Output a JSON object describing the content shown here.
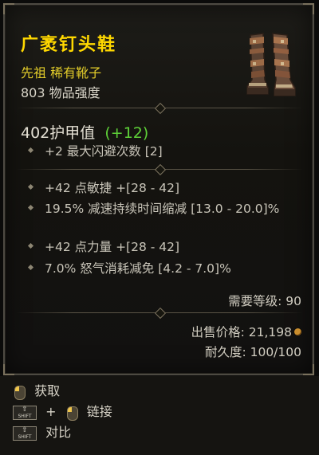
{
  "item": {
    "name": "广袤钉头鞋",
    "type": "先祖 稀有靴子",
    "power": "803 物品强度",
    "icon": "boots-icon"
  },
  "armor": {
    "value": "402护甲值",
    "bonus": "(+12)"
  },
  "implicit": [
    {
      "text": "+2 最大闪避次数 [2]"
    }
  ],
  "affixes": [
    {
      "text": "+42 点敏捷 +[28 - 42]"
    },
    {
      "text": "19.5% 减速持续时间缩减 [13.0 - 20.0]%"
    },
    {
      "text": "+42 点力量 +[28 - 42]"
    },
    {
      "text": "7.0% 怒气消耗减免 [4.2 - 7.0]%"
    }
  ],
  "requirement": "需要等级: 90",
  "sell_price": "出售价格:  21,198",
  "durability": "耐久度: 100/100",
  "controls": [
    {
      "label": "获取",
      "keys": [
        "mouse-left"
      ]
    },
    {
      "label": "链接",
      "keys": [
        "shift",
        "mouse-left"
      ]
    },
    {
      "label": "对比",
      "keys": [
        "shift"
      ]
    }
  ],
  "shift_text": "SHIFT",
  "plus": "+",
  "colors": {
    "name": "#ffd800",
    "type": "#e2cc2a",
    "bonus": "#5ed138",
    "text": "#d8d4c8"
  }
}
